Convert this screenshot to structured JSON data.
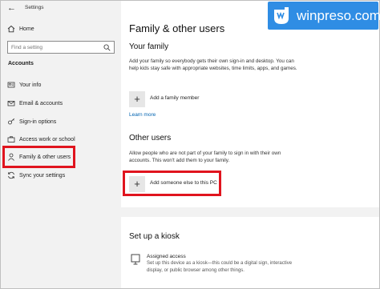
{
  "window": {
    "title": "Settings"
  },
  "sidebar": {
    "home_label": "Home",
    "search_placeholder": "Find a setting",
    "section_header": "Accounts",
    "items": [
      {
        "label": "Your info",
        "icon": "person-card-icon"
      },
      {
        "label": "Email & accounts",
        "icon": "email-icon"
      },
      {
        "label": "Sign-in options",
        "icon": "key-icon"
      },
      {
        "label": "Access work or school",
        "icon": "briefcase-icon"
      },
      {
        "label": "Family & other users",
        "icon": "people-icon"
      },
      {
        "label": "Sync your settings",
        "icon": "sync-icon"
      }
    ]
  },
  "main": {
    "title": "Family & other users",
    "your_family": {
      "heading": "Your family",
      "description": "Add your family so everybody gets their own sign-in and desktop. You can help kids stay safe with appropriate websites, time limits, apps, and games.",
      "add_label": "Add a family member",
      "learn_more": "Learn more"
    },
    "other_users": {
      "heading": "Other users",
      "description": "Allow people who are not part of your family to sign in with their own accounts. This won't add them to your family.",
      "add_label": "Add someone else to this PC"
    },
    "kiosk": {
      "heading": "Set up a kiosk",
      "title": "Assigned access",
      "description": "Set up this device as a kiosk—this could be a digital sign, interactive display, or public browser among other things."
    }
  },
  "watermark": {
    "text": "winpreso.com"
  },
  "colors": {
    "highlight": "#e0141e",
    "accent_link": "#0063b1",
    "watermark_bg": "#2f8de4"
  }
}
